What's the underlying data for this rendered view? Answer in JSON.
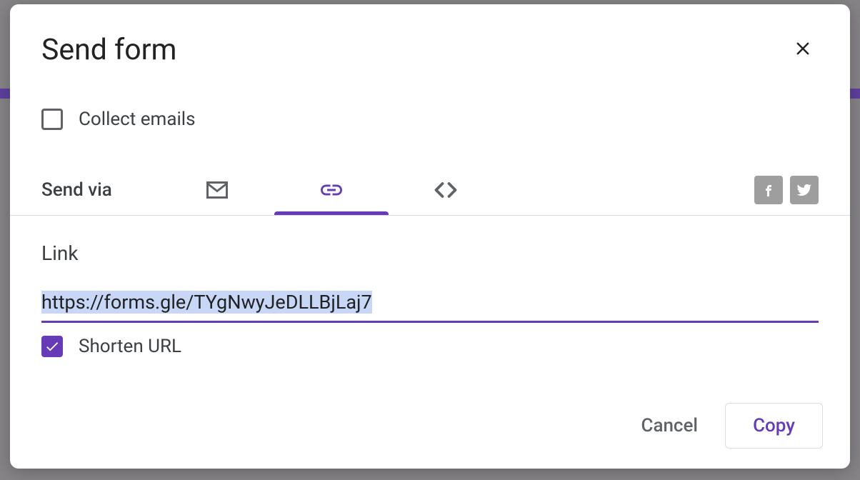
{
  "dialog": {
    "title": "Send form",
    "collect_emails_label": "Collect emails",
    "collect_emails_checked": false,
    "send_via_label": "Send via",
    "section_label": "Link",
    "link_value": "https://forms.gle/TYgNwyJeDLLBjLaj7",
    "shorten_label": "Shorten URL",
    "shorten_checked": true,
    "cancel_label": "Cancel",
    "copy_label": "Copy"
  },
  "colors": {
    "accent": "#673ab7"
  }
}
